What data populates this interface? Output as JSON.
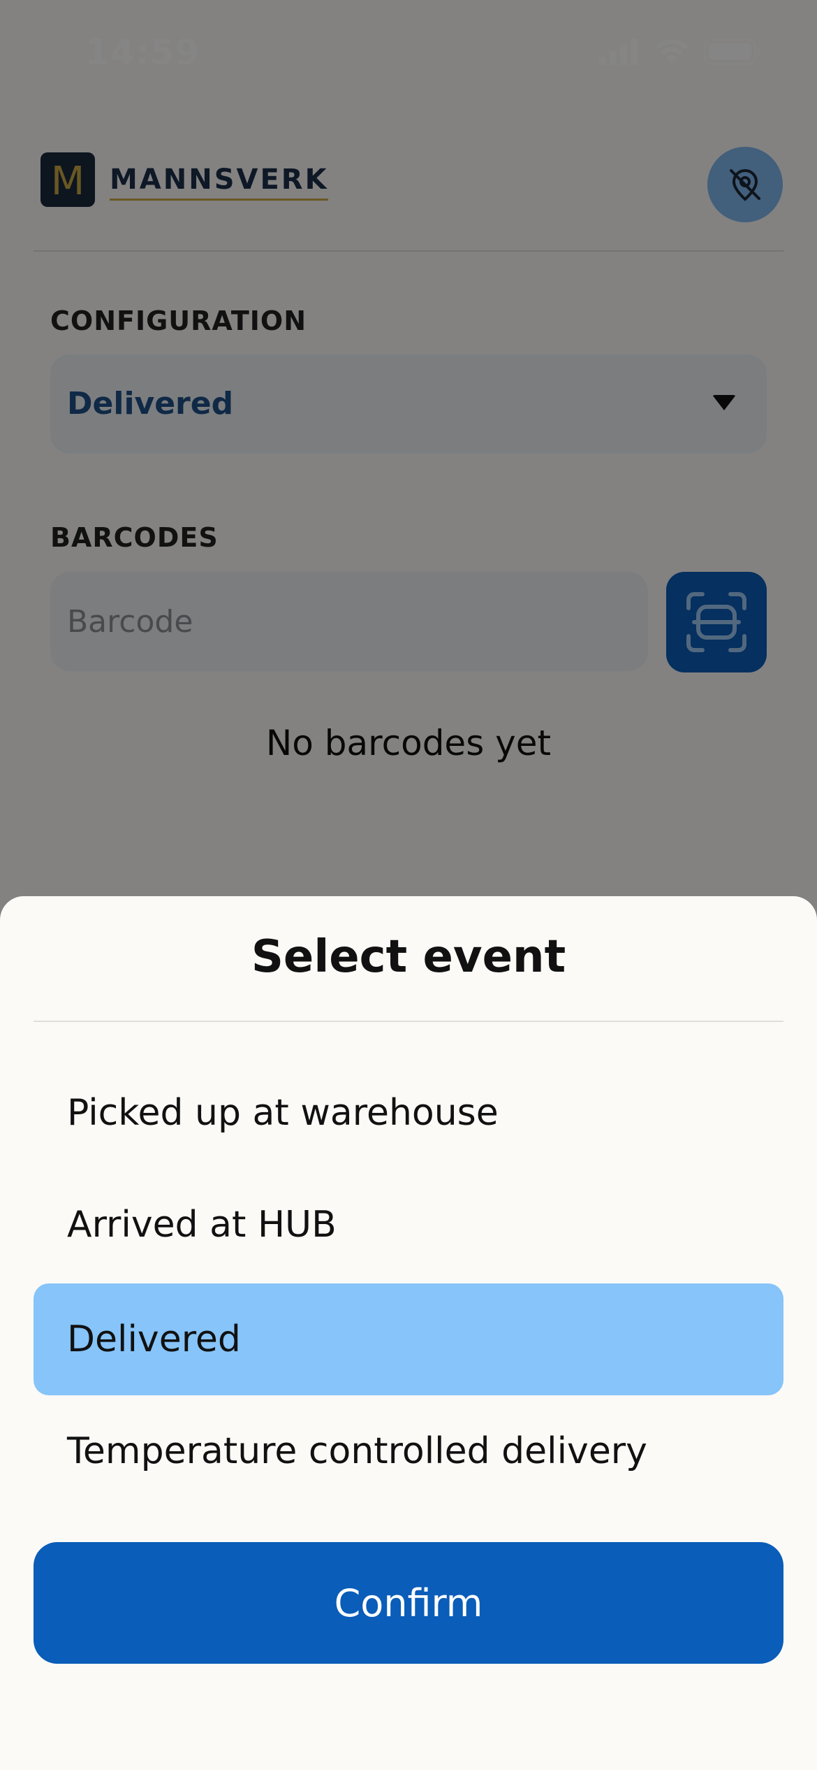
{
  "status_bar": {
    "time": "14:59"
  },
  "header": {
    "brand": "MANNSVERK",
    "logo_letter": "M"
  },
  "configuration": {
    "label": "CONFIGURATION",
    "selected": "Delivered"
  },
  "barcodes": {
    "label": "BARCODES",
    "placeholder": "Barcode",
    "empty_text": "No barcodes yet"
  },
  "sheet": {
    "title": "Select event",
    "options": [
      {
        "label": "Picked up at warehouse"
      },
      {
        "label": "Arrived at HUB"
      },
      {
        "label": "Delivered"
      },
      {
        "label": "Temperature controlled delivery"
      }
    ],
    "selected_index": 2,
    "confirm_label": "Confirm"
  },
  "colors": {
    "primary": "#0a5db8",
    "selected_option": "#86c4f9",
    "logo_gold": "#c9a945",
    "logo_navy": "#1a2a3d"
  },
  "icons": {
    "header_button": "location-off-icon",
    "scan_button": "barcode-scan-icon"
  }
}
